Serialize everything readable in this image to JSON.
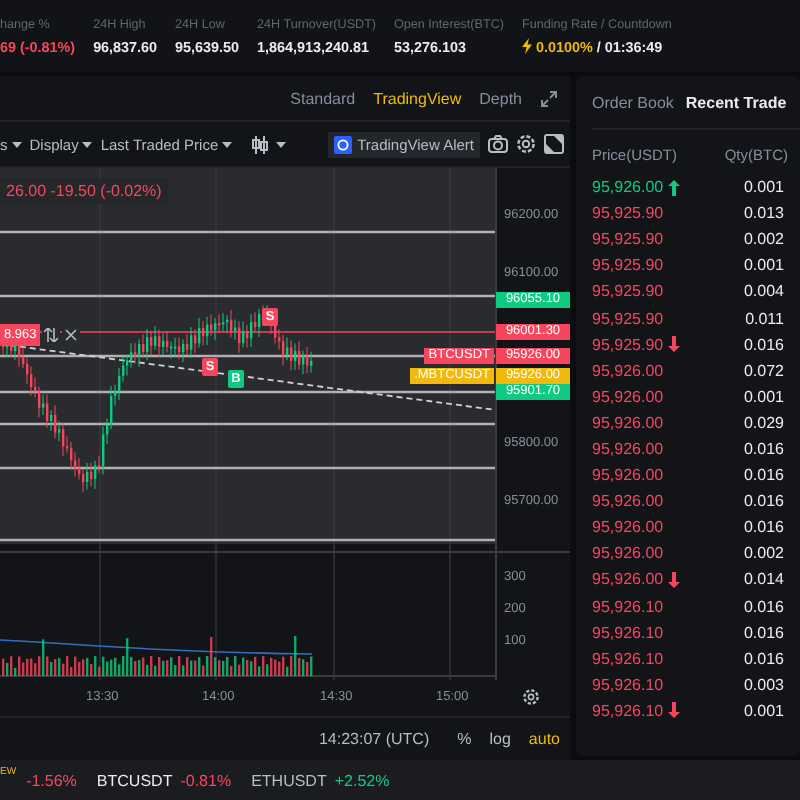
{
  "stats": [
    {
      "label": "hange %",
      "value": "69 (-0.81%)",
      "kind": "down"
    },
    {
      "label": "24H High",
      "value": "96,837.60",
      "kind": "plain"
    },
    {
      "label": "24H Low",
      "value": "95,639.50",
      "kind": "plain"
    },
    {
      "label": "24H Turnover(USDT)",
      "value": "1,864,913,240.81",
      "kind": "plain"
    },
    {
      "label": "Open Interest(BTC)",
      "value": "53,276.103",
      "kind": "plain"
    },
    {
      "label": "Funding Rate / Countdown",
      "value": "0.0100%",
      "countdown": "/ 01:36:49",
      "kind": "funding"
    }
  ],
  "chart": {
    "views": [
      {
        "label": "Standard",
        "selected": false
      },
      {
        "label": "TradingView",
        "selected": true
      },
      {
        "label": "Depth",
        "selected": false
      }
    ],
    "menus": [
      "s",
      "Display",
      "Last Traded Price"
    ],
    "alert_button": "TradingView Alert",
    "legend": "26.00 -19.50 (-0.02%)",
    "price_axis": [
      "96200.00",
      "96100.00",
      "95800.00",
      "95700.00"
    ],
    "price_tags": [
      {
        "value": "96055.10",
        "color": "#0ecb81"
      },
      {
        "value": "96001.30",
        "color": "#f6465d"
      },
      {
        "symbol": "BTCUSDT",
        "value": "95926.00",
        "color": "#f6465d"
      },
      {
        "symbol": ".MBTCUSDT",
        "value": "95926.00",
        "color": "#f0b90b"
      },
      {
        "value": "95901.70",
        "color": "#0ecb81"
      }
    ],
    "position_tag": "8.963",
    "markers": [
      {
        "label": "S",
        "kind": "sell"
      },
      {
        "label": "S",
        "kind": "sell"
      },
      {
        "label": "B",
        "kind": "buy"
      }
    ],
    "volume_axis": [
      "300",
      "200",
      "100"
    ],
    "time_axis": [
      "13:30",
      "14:00",
      "14:30",
      "15:00"
    ],
    "clock": "14:23:07 (UTC)",
    "scale_options": [
      {
        "label": "%",
        "selected": false
      },
      {
        "label": "log",
        "selected": false
      },
      {
        "label": "auto",
        "selected": true
      }
    ]
  },
  "trades": {
    "tabs": [
      {
        "label": "Order Book",
        "selected": false
      },
      {
        "label": "Recent Trade",
        "selected": true
      }
    ],
    "columns": [
      "Price(USDT)",
      "Qty(BTC)"
    ],
    "rows": [
      {
        "price": "95,926.00",
        "qty": "0.001",
        "kind": "buy",
        "arrow_up": true,
        "arrow_down": false
      },
      {
        "price": "95,925.90",
        "qty": "0.013",
        "kind": "sell",
        "arrow_up": false,
        "arrow_down": false
      },
      {
        "price": "95,925.90",
        "qty": "0.002",
        "kind": "sell",
        "arrow_up": false,
        "arrow_down": false
      },
      {
        "price": "95,925.90",
        "qty": "0.001",
        "kind": "sell",
        "arrow_up": false,
        "arrow_down": false
      },
      {
        "price": "95,925.90",
        "qty": "0.004",
        "kind": "sell",
        "arrow_up": false,
        "arrow_down": false
      },
      {
        "price": "95,925.90",
        "qty": "0.011",
        "kind": "sell",
        "arrow_up": false,
        "arrow_down": false
      },
      {
        "price": "95,925.90",
        "qty": "0.016",
        "kind": "sell",
        "arrow_up": false,
        "arrow_down": true
      },
      {
        "price": "95,926.00",
        "qty": "0.072",
        "kind": "sell",
        "arrow_up": false,
        "arrow_down": false
      },
      {
        "price": "95,926.00",
        "qty": "0.001",
        "kind": "sell",
        "arrow_up": false,
        "arrow_down": false
      },
      {
        "price": "95,926.00",
        "qty": "0.029",
        "kind": "sell",
        "arrow_up": false,
        "arrow_down": false
      },
      {
        "price": "95,926.00",
        "qty": "0.016",
        "kind": "sell",
        "arrow_up": false,
        "arrow_down": false
      },
      {
        "price": "95,926.00",
        "qty": "0.016",
        "kind": "sell",
        "arrow_up": false,
        "arrow_down": false
      },
      {
        "price": "95,926.00",
        "qty": "0.016",
        "kind": "sell",
        "arrow_up": false,
        "arrow_down": false
      },
      {
        "price": "95,926.00",
        "qty": "0.016",
        "kind": "sell",
        "arrow_up": false,
        "arrow_down": false
      },
      {
        "price": "95,926.00",
        "qty": "0.002",
        "kind": "sell",
        "arrow_up": false,
        "arrow_down": false
      },
      {
        "price": "95,926.00",
        "qty": "0.014",
        "kind": "sell",
        "arrow_up": false,
        "arrow_down": true
      },
      {
        "price": "95,926.10",
        "qty": "0.016",
        "kind": "sell",
        "arrow_up": false,
        "arrow_down": false
      },
      {
        "price": "95,926.10",
        "qty": "0.016",
        "kind": "sell",
        "arrow_up": false,
        "arrow_down": false
      },
      {
        "price": "95,926.10",
        "qty": "0.016",
        "kind": "sell",
        "arrow_up": false,
        "arrow_down": false
      },
      {
        "price": "95,926.10",
        "qty": "0.003",
        "kind": "sell",
        "arrow_up": false,
        "arrow_down": false
      },
      {
        "price": "95,926.10",
        "qty": "0.001",
        "kind": "sell",
        "arrow_up": false,
        "arrow_down": true
      }
    ]
  },
  "ticker": {
    "badge": "EW",
    "items": [
      {
        "change": "-1.56%",
        "rising": false
      },
      {
        "symbol": "BTCUSDT",
        "change": "-0.81%",
        "rising": false
      },
      {
        "symbol": "ETHUSDT",
        "change": "+2.52%",
        "rising": true
      }
    ]
  }
}
